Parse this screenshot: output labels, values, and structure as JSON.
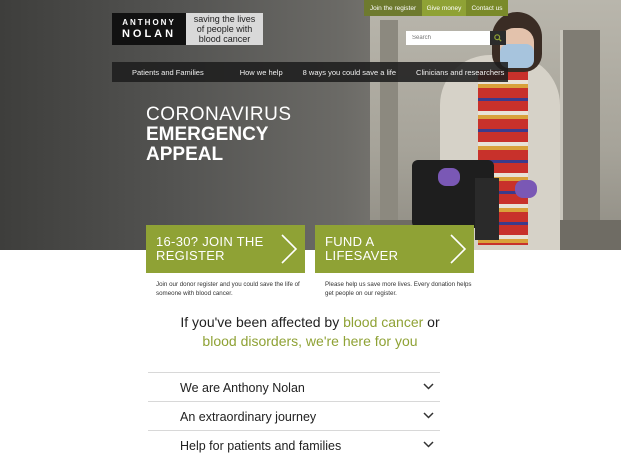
{
  "logo": {
    "line1": "ANTHONY",
    "line2": "NOLAN",
    "tagline": "saving the lives of people with blood cancer"
  },
  "utility": {
    "join_register": "Join the register",
    "give_money": "Give money",
    "contact_us": "Contact us"
  },
  "search": {
    "placeholder": "Search"
  },
  "nav": {
    "items": [
      {
        "label": "Patients and Families"
      },
      {
        "label": "How we help"
      },
      {
        "label": "8 ways you could save a life"
      },
      {
        "label": "Clinicians and researchers"
      }
    ]
  },
  "hero": {
    "line1": "CORONAVIRUS",
    "line2": "EMERGENCY",
    "line3": "APPEAL"
  },
  "cta": [
    {
      "label": "16-30? JOIN THE REGISTER",
      "desc": "Join our donor register and you could save the life of someone with blood cancer."
    },
    {
      "label": "FUND A LIFESAVER",
      "desc": "Please help us save more lives. Every donation helps get people on our register."
    }
  ],
  "affected": {
    "t1": "If you've been affected by ",
    "t2": "blood cancer",
    "t3": " or",
    "t4": "blood disorders",
    "t5": ", we're here for you"
  },
  "accordion": [
    {
      "label": "We are Anthony Nolan"
    },
    {
      "label": "An extraordinary journey"
    },
    {
      "label": "Help for patients and families"
    }
  ],
  "colors": {
    "brand_green": "#8fa235",
    "dark": "#111111"
  }
}
